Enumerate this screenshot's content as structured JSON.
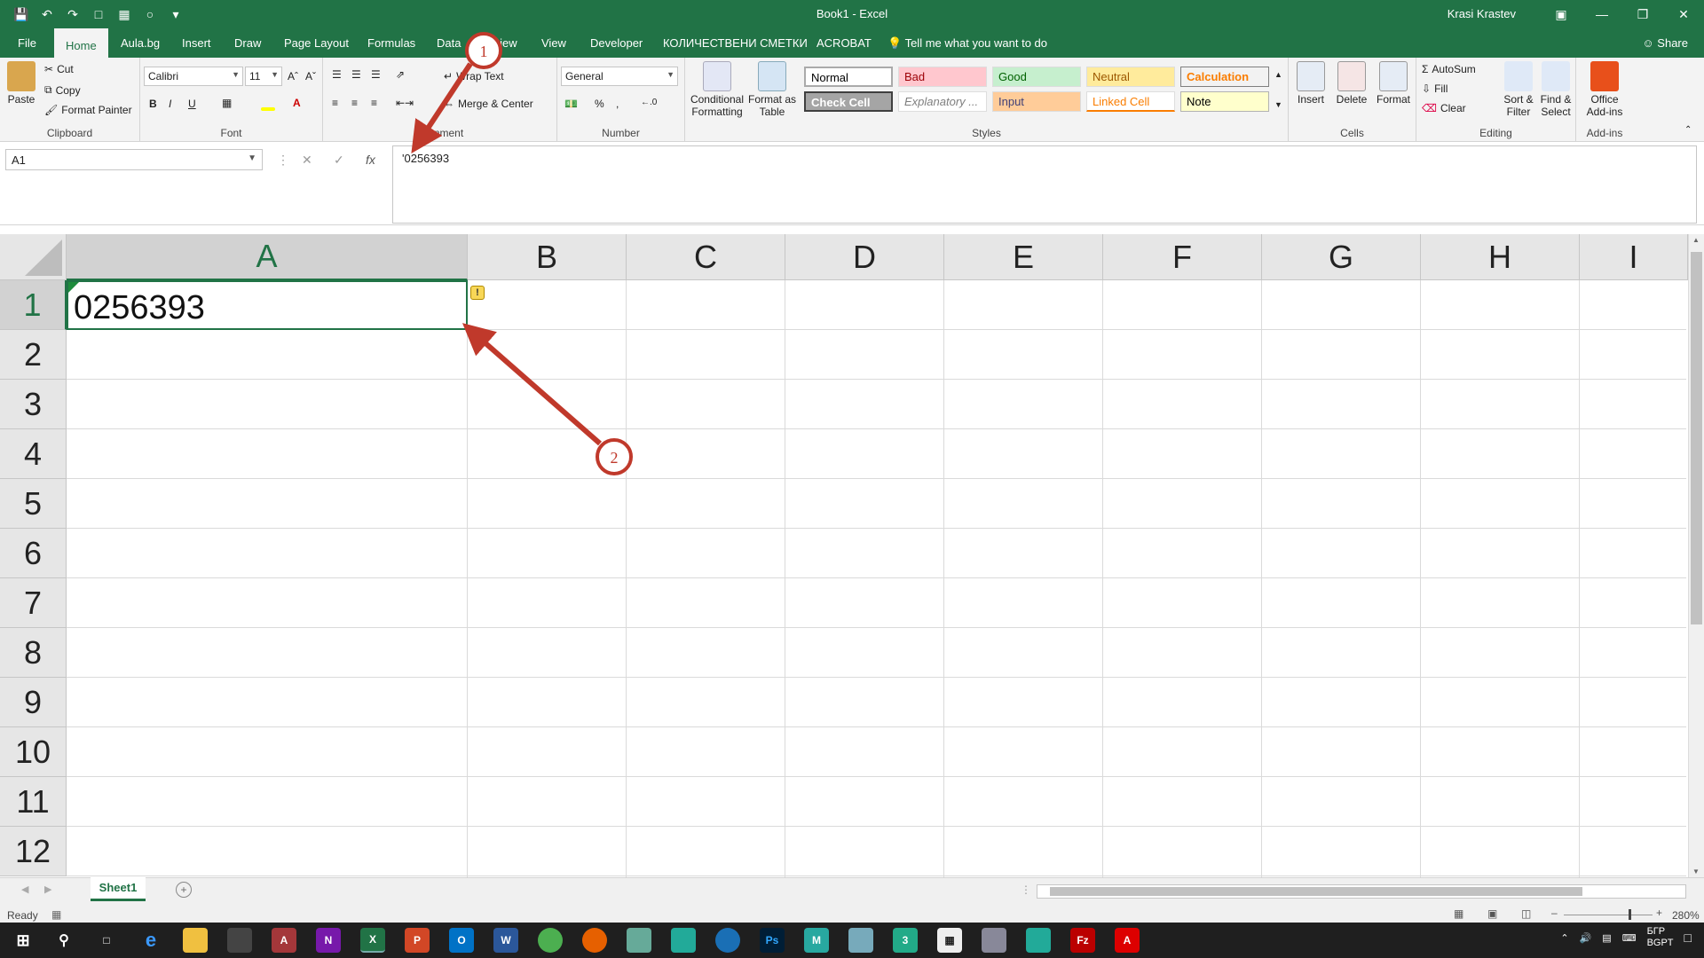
{
  "window": {
    "title": "Book1  -  Excel",
    "user": "Krasi Krastev"
  },
  "ribbon_tabs": [
    "File",
    "Home",
    "Aula.bg",
    "Insert",
    "Draw",
    "Page Layout",
    "Formulas",
    "Data",
    "Review",
    "View",
    "Developer",
    "КОЛИЧЕСТВЕНИ СМЕТКИ",
    "ACROBAT"
  ],
  "active_tab": "Home",
  "tell_me": "Tell me what you want to do",
  "share": "Share",
  "clipboard": {
    "paste": "Paste",
    "cut": "Cut",
    "copy": "Copy",
    "format_painter": "Format Painter",
    "label": "Clipboard"
  },
  "font": {
    "name": "Calibri",
    "size": "11",
    "bold": "B",
    "italic": "I",
    "underline": "U",
    "label": "Font"
  },
  "alignment": {
    "wrap": "Wrap Text",
    "merge": "Merge & Center",
    "label": "Alignment"
  },
  "number": {
    "format": "General",
    "percent": "%",
    "comma": ",",
    "label": "Number"
  },
  "styles_group": {
    "cond": "Conditional Formatting",
    "table": "Format as Table",
    "label": "Styles",
    "items": [
      {
        "name": "Normal",
        "bg": "#ffffff",
        "fg": "#000000"
      },
      {
        "name": "Bad",
        "bg": "#ffc7ce",
        "fg": "#9c0006"
      },
      {
        "name": "Good",
        "bg": "#c6efce",
        "fg": "#006100"
      },
      {
        "name": "Neutral",
        "bg": "#ffeb9c",
        "fg": "#9c5700"
      },
      {
        "name": "Calculation",
        "bg": "#f2f2f2",
        "fg": "#fa7d00"
      },
      {
        "name": "Check Cell",
        "bg": "#a5a5a5",
        "fg": "#ffffff"
      },
      {
        "name": "Explanatory ...",
        "bg": "#ffffff",
        "fg": "#7f7f7f"
      },
      {
        "name": "Input",
        "bg": "#ffcc99",
        "fg": "#3f3f76"
      },
      {
        "name": "Linked Cell",
        "bg": "#ffffff",
        "fg": "#fa7d00"
      },
      {
        "name": "Note",
        "bg": "#ffffcc",
        "fg": "#000000"
      }
    ]
  },
  "cells_group": {
    "insert": "Insert",
    "delete": "Delete",
    "format": "Format",
    "label": "Cells"
  },
  "editing": {
    "autosum": "AutoSum",
    "fill": "Fill",
    "clear": "Clear",
    "sort": "Sort & Filter",
    "find": "Find & Select",
    "label": "Editing"
  },
  "addins": {
    "office": "Office Add-ins",
    "label": "Add-ins"
  },
  "formula_bar": {
    "name_box": "A1",
    "formula": "'0256393",
    "fx": "fx"
  },
  "columns": [
    "A",
    "B",
    "C",
    "D",
    "E",
    "F",
    "G",
    "H",
    "I"
  ],
  "rows": [
    "1",
    "2",
    "3",
    "4",
    "5",
    "6",
    "7",
    "8",
    "9",
    "10",
    "11",
    "12"
  ],
  "cell_a1": "0256393",
  "sheet_tab": "Sheet1",
  "status": {
    "ready": "Ready",
    "zoom": "280%"
  },
  "callouts": [
    "1",
    "2"
  ],
  "tray": {
    "lang1": "БГР",
    "lang2": "BGPT"
  },
  "colors": {
    "excel_green": "#217346",
    "arrow": "#c0392b"
  }
}
